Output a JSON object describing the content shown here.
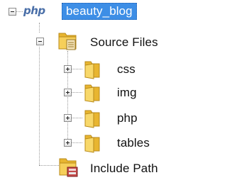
{
  "tree": {
    "project": {
      "logo_text": "php",
      "name": "beauty_blog",
      "selected": true,
      "expanded": true
    },
    "source_files": {
      "label": "Source Files",
      "icon": "source-folder-icon",
      "expanded": true,
      "children": [
        {
          "label": "css",
          "icon": "folder-icon",
          "expanded": false
        },
        {
          "label": "img",
          "icon": "folder-icon",
          "expanded": false
        },
        {
          "label": "php",
          "icon": "folder-icon",
          "expanded": false
        },
        {
          "label": "tables",
          "icon": "folder-icon",
          "expanded": false
        }
      ]
    },
    "include_path": {
      "label": "Include Path",
      "icon": "library-folder-icon"
    }
  },
  "colors": {
    "selection": "#3d8ee6",
    "folder": "#f2c24a",
    "php_logo": "#4a6fa8"
  }
}
